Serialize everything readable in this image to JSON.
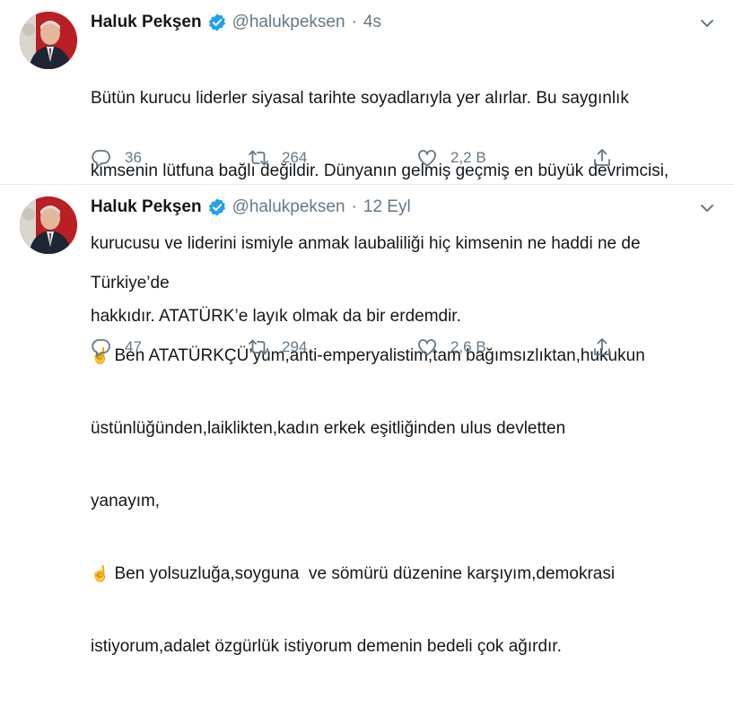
{
  "tweets": [
    {
      "name": "Haluk Pekşen",
      "handle": "@halukpeksen",
      "sep": "·",
      "time": "4s",
      "lines": [
        "Bütün kurucu liderler siyasal tarihte soyadlarıyla yer alırlar. Bu saygınlık",
        "kimsenin lütfuna bağlı değildir. Dünyanın gelmiş geçmiş en büyük devrimcisi,",
        "kurucusu ve liderini ismiyle anmak laubaliliği hiç kimsenin ne haddi ne de",
        "hakkıdır. ATATÜRK’e layık olmak da bir erdemdir."
      ],
      "replies": "36",
      "retweets": "264",
      "likes": "2,2 B"
    },
    {
      "name": "Haluk Pekşen",
      "handle": "@halukpeksen",
      "sep": "·",
      "time": "12 Eyl",
      "lines": [
        "Türkiye’de",
        " Ben ATATÜRKÇÜ’yüm,anti-emperyalistim,tam bağımsızlıktan,hukukun",
        "üstünlüğünden,laiklikten,kadın erkek eşitliğinden ulus devletten",
        "yanayım,",
        " Ben yolsuzluğa,soyguna  ve sömürü düzenine karşıyım,demokrasi",
        "istiyorum,adalet özgürlük istiyorum demenin bedeli çok ağırdır."
      ],
      "finger": "☝️",
      "replies": "47",
      "retweets": "294",
      "likes": "2,6 B"
    }
  ],
  "icons": {
    "verified": "verified-badge-icon",
    "more": "chevron-down-icon",
    "reply": "reply-icon",
    "retweet": "retweet-icon",
    "like": "heart-icon",
    "share": "share-icon"
  },
  "colors": {
    "accent": "#1da1f2",
    "secondary_text": "#657786",
    "divider": "#e6ecf0",
    "avatar_bg": "#b91f24"
  }
}
